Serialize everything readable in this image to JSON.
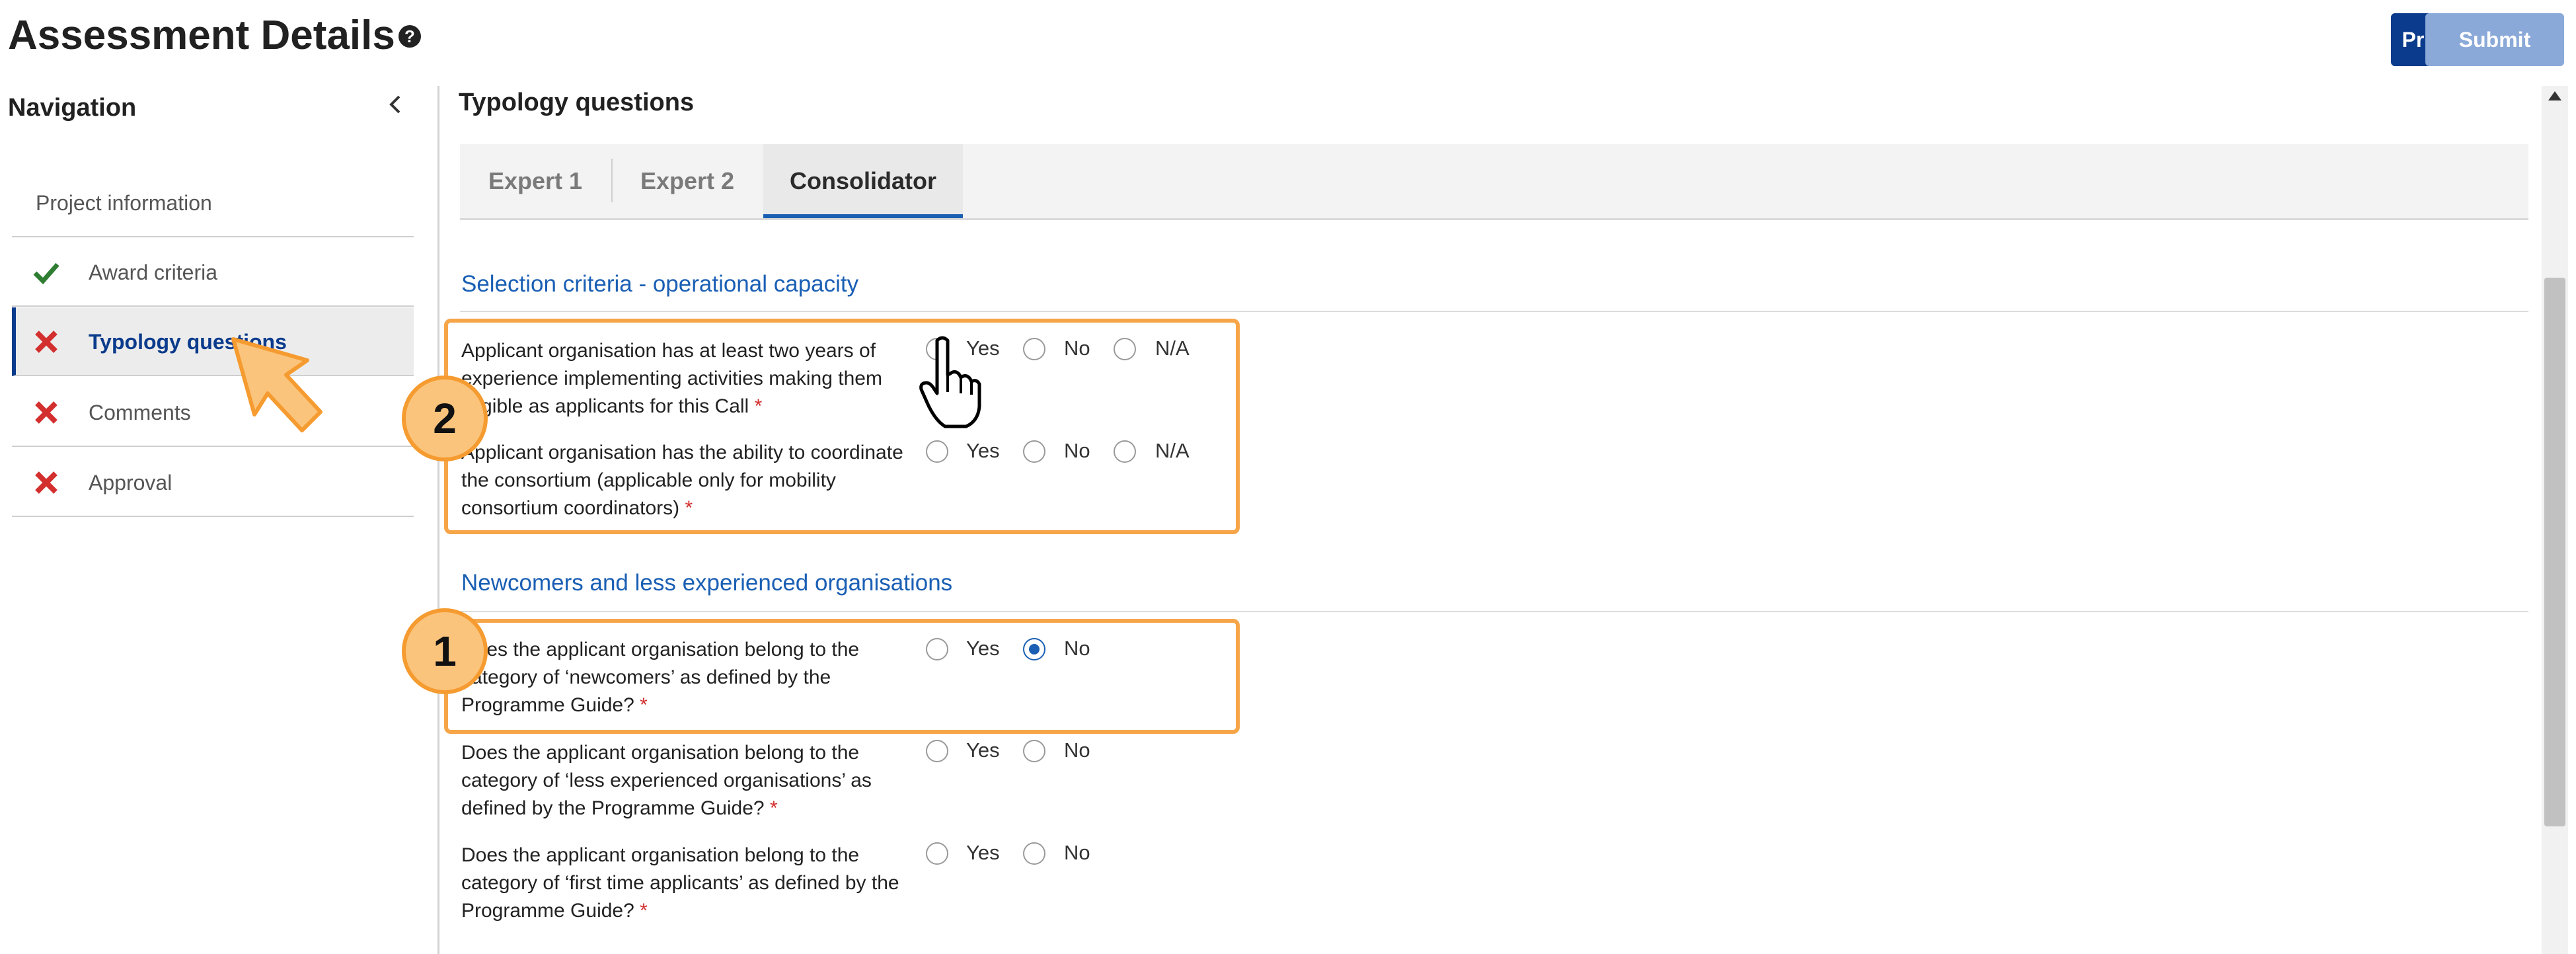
{
  "header": {
    "title": "Assessment Details",
    "print_label": "Print",
    "submit_label": "Submit"
  },
  "sidebar": {
    "title": "Navigation",
    "items": [
      {
        "label": "Project information",
        "status": "none"
      },
      {
        "label": "Award criteria",
        "status": "complete"
      },
      {
        "label": "Typology questions",
        "status": "error",
        "active": true
      },
      {
        "label": "Comments",
        "status": "error"
      },
      {
        "label": "Approval",
        "status": "error"
      }
    ]
  },
  "main": {
    "title": "Typology questions",
    "tabs": [
      {
        "label": "Expert 1"
      },
      {
        "label": "Expert 2"
      },
      {
        "label": "Consolidator",
        "active": true
      }
    ],
    "groups": [
      {
        "title": "Selection criteria - operational capacity",
        "questions": [
          {
            "text": "Applicant organisation has at least two years of experience implementing activities making them eligible as applicants for this Call",
            "options": [
              "Yes",
              "No",
              "N/A"
            ],
            "selected": null
          },
          {
            "text": "Applicant organisation has the ability to coordinate the consortium (applicable only for mobility consortium coordinators)",
            "options": [
              "Yes",
              "No",
              "N/A"
            ],
            "selected": null
          }
        ]
      },
      {
        "title": "Newcomers and less experienced organisations",
        "questions": [
          {
            "text": "Does the applicant organisation belong to the category of ‘newcomers’ as defined by the Programme Guide?",
            "options": [
              "Yes",
              "No"
            ],
            "selected": "No"
          },
          {
            "text": "Does the applicant organisation belong to the category of ‘less experienced organisations’ as defined by the Programme Guide?",
            "options": [
              "Yes",
              "No"
            ],
            "selected": null
          },
          {
            "text": "Does the applicant organisation belong to the category of ‘first time applicants’ as defined by the Programme Guide?",
            "options": [
              "Yes",
              "No"
            ],
            "selected": null
          }
        ]
      }
    ],
    "required_marker": "*"
  },
  "annotations": {
    "badge_1": "1",
    "badge_2": "2"
  },
  "colors": {
    "accent": "#1a5fb4",
    "primary_button": "#0b3b8c",
    "highlight": "#f6a548",
    "error": "#d32f2f",
    "success": "#2e7d32"
  }
}
